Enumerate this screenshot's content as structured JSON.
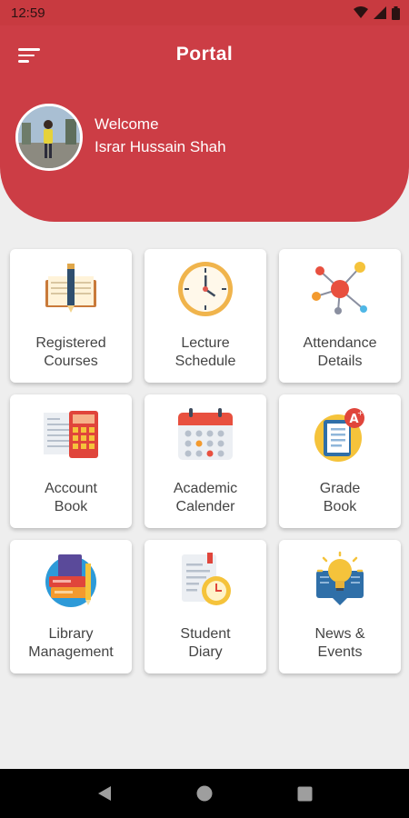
{
  "status_bar": {
    "time": "12:59"
  },
  "header": {
    "title": "Portal",
    "welcome": "Welcome",
    "user_name": "Israr Hussain Shah"
  },
  "cards": [
    {
      "label": "Registered\nCourses",
      "icon": "book-pencil-icon"
    },
    {
      "label": "Lecture\nSchedule",
      "icon": "clock-icon"
    },
    {
      "label": "Attendance\nDetails",
      "icon": "network-icon"
    },
    {
      "label": "Account\nBook",
      "icon": "calculator-icon"
    },
    {
      "label": "Academic\nCalender",
      "icon": "calendar-icon"
    },
    {
      "label": "Grade\nBook",
      "icon": "grade-book-icon"
    },
    {
      "label": "Library\nManagement",
      "icon": "library-books-icon"
    },
    {
      "label": "Student\nDiary",
      "icon": "diary-clock-icon"
    },
    {
      "label": "News &\nEvents",
      "icon": "lightbulb-news-icon"
    }
  ],
  "colors": {
    "primary": "#cc3d45",
    "background": "#eeeeee",
    "card": "#ffffff"
  }
}
